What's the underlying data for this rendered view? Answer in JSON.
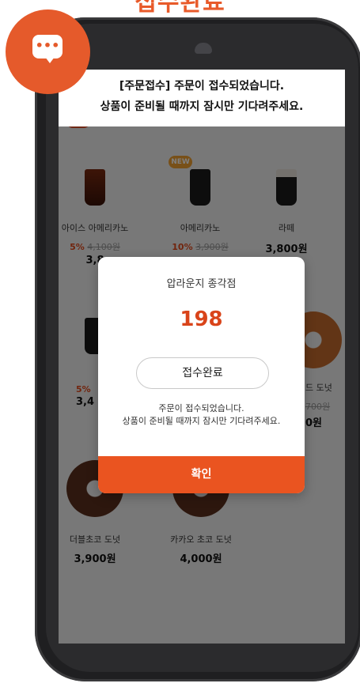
{
  "page_title": "접수완료",
  "chat_button": {
    "dots": "•••"
  },
  "notice": {
    "line1": "[주문접수] 주문이 접수되었습니다.",
    "line2": "상품이 준비될 때까지 잠시만 기다려주세요."
  },
  "menu": {
    "new_badge": "NEW",
    "items": [
      {
        "name": "아이스 아메리카노",
        "discount": "5%",
        "old_price": "4,100원",
        "price": "3,8"
      },
      {
        "name": "아메리카노",
        "discount": "10%",
        "old_price": "3,900원",
        "price": ""
      },
      {
        "name": "라떼",
        "discount": "",
        "old_price": "",
        "price": "3,800원"
      },
      {
        "name": "",
        "discount": "5%",
        "old_price": "",
        "price": "3,4"
      },
      {
        "name": "드 도넛",
        "discount": "",
        "old_price": "700원",
        "price": "0원"
      },
      {
        "name": "더블초코 도넛",
        "discount": "",
        "old_price": "",
        "price": "3,900원"
      },
      {
        "name": "카카오 초코 도넛",
        "discount": "",
        "old_price": "",
        "price": "4,000원"
      }
    ]
  },
  "modal": {
    "store_name": "압라운지 종각점",
    "order_number": "198",
    "status": "접수완료",
    "message_line1": "주문이 접수되었습니다.",
    "message_line2": "상품이 준비될 때까지 잠시만 기다려주세요.",
    "confirm_label": "확인"
  },
  "colors": {
    "accent": "#ea5420",
    "order_number": "#d9441a",
    "dim": "#000000"
  }
}
